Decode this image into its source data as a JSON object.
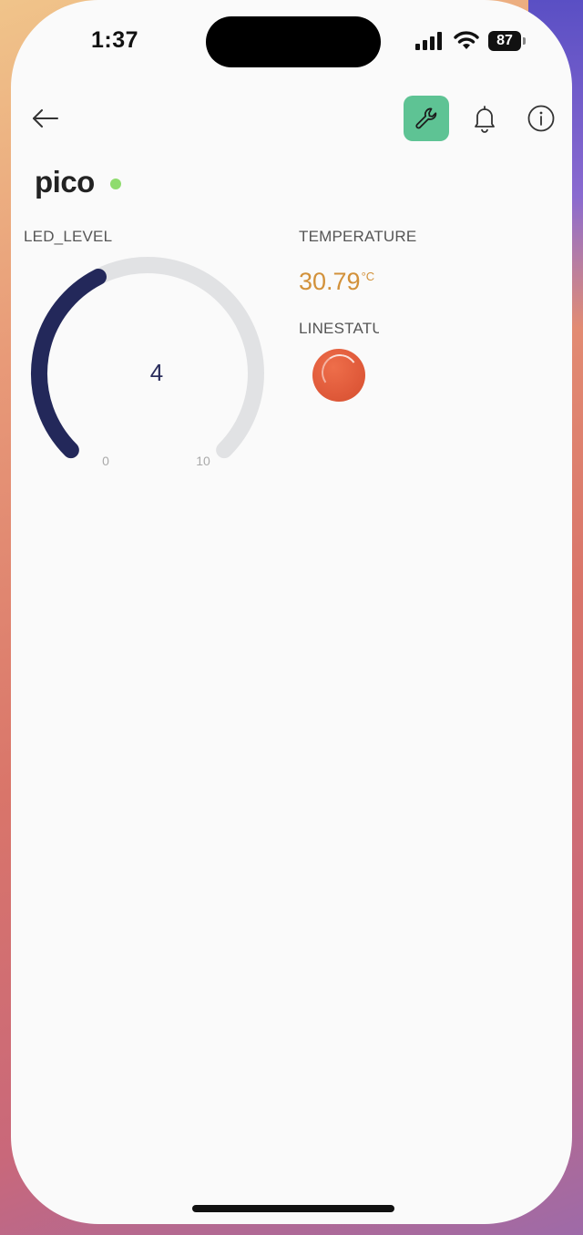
{
  "status_bar": {
    "time": "1:37",
    "battery": "87"
  },
  "device": {
    "name": "pico",
    "online_color": "#8fdc6e"
  },
  "toolbar": {
    "back_icon": "arrow-left-icon",
    "wrench_icon": "wrench-icon",
    "bell_icon": "bell-icon",
    "info_icon": "info-icon",
    "accent": "#5ec394"
  },
  "widgets": {
    "led_level": {
      "label": "LED_LEVEL",
      "value": "4",
      "min": "0",
      "max": "10",
      "fraction": 0.4,
      "fill_color": "#23285a",
      "track_color": "#e1e2e4"
    },
    "temperature": {
      "label": "TEMPERATURE",
      "value": "30.79",
      "unit": "°C",
      "color": "#d2913a"
    },
    "linestatus": {
      "label": "LINESTATUS",
      "indicator_color": "#e05a3a"
    }
  }
}
